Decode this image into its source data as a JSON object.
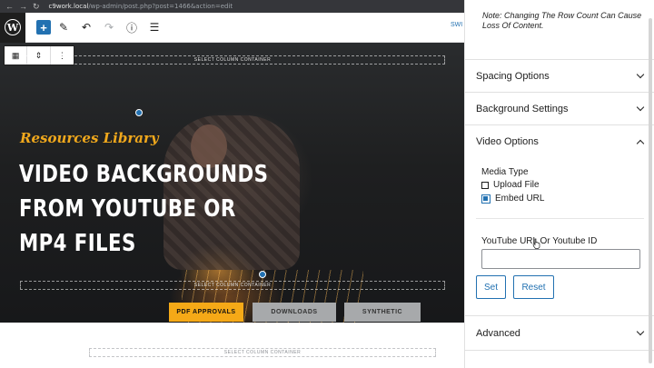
{
  "browser": {
    "url_host": "c9work.local",
    "url_path": "/wp-admin/post.php?post=1466&action=edit",
    "back_glyph": "←",
    "forward_glyph": "→",
    "reload_glyph": "↻",
    "lock_glyph": "🔒"
  },
  "toolbar": {
    "wp_logo": "W",
    "add_glyph": "+",
    "edit_glyph": "✎",
    "undo_glyph": "↶",
    "redo_glyph": "↷",
    "info_glyph": "ⓘ",
    "list_glyph": "☰",
    "right_text": "SWI"
  },
  "block_toolbar": {
    "columns_glyph": "▦",
    "move_glyph": "⇕",
    "more_glyph": "⋮"
  },
  "canvas": {
    "column_container_label": "SELECT COLUMN CONTAINER",
    "kicker": "Resources Library",
    "headline_lines": [
      "VIDEO BACKGROUNDS",
      "FROM YOUTUBE OR",
      "MP4 FILES"
    ],
    "buttons": [
      "PDF APPROVALS",
      "DOWNLOADS",
      "SYNTHETIC"
    ]
  },
  "sidebar": {
    "note": "Note: Changing The Row Count Can Cause Loss Of Content.",
    "panels": {
      "spacing": "Spacing Options",
      "background": "Background Settings",
      "video": "Video Options",
      "advanced": "Advanced"
    },
    "video": {
      "media_type_label": "Media Type",
      "options": [
        {
          "label": "Upload File",
          "checked": false
        },
        {
          "label": "Embed URL",
          "checked": true
        }
      ],
      "youtube_label": "YouTube URL Or Youtube ID",
      "youtube_value": "",
      "set_label": "Set",
      "reset_label": "Reset"
    }
  },
  "colors": {
    "accent": "#2271b1",
    "kicker": "#f0a81c",
    "pdf_button": "#f5a917",
    "grey_button": "#a7a9ab"
  }
}
